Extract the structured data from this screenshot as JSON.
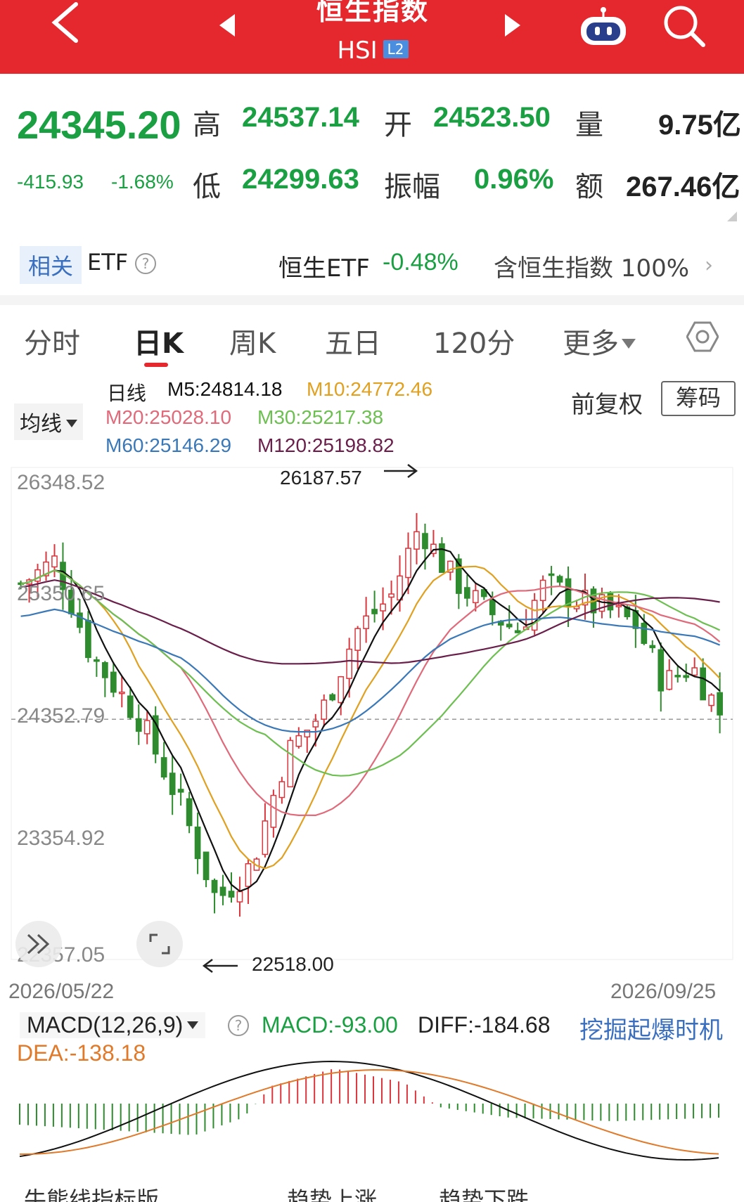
{
  "header": {
    "title": "恒生指数",
    "code": "HSI",
    "badge": "L2"
  },
  "quote": {
    "price": "24345.20",
    "change": "-415.93",
    "change_pct": "-1.68%",
    "high_label": "高",
    "high": "24537.14",
    "open_label": "开",
    "open": "24523.50",
    "volume_label": "量",
    "volume": "9.75亿",
    "low_label": "低",
    "low": "24299.63",
    "amplitude_label": "振幅",
    "amplitude": "0.96%",
    "amount_label": "额",
    "amount": "267.46亿"
  },
  "etf": {
    "tag": "相关",
    "label": "ETF",
    "help": "?",
    "name": "恒生ETF",
    "pct": "-0.48%",
    "holding": "含恒生指数 100%",
    "chevron": "›"
  },
  "tabs": [
    "分时",
    "日K",
    "周K",
    "五日",
    "120分",
    "更多"
  ],
  "ma": {
    "selector": "均线",
    "daily": "日线",
    "m5": "M5:24814.18",
    "m10": "M10:24772.46",
    "m20": "M20:25028.10",
    "m30": "M30:25217.38",
    "m60": "M60:25146.29",
    "m120": "M120:25198.82",
    "adjust": "前复权",
    "chips": "筹码"
  },
  "colors": {
    "up": "#d9363e",
    "down": "#2e8b2e",
    "m5": "#111111",
    "m10": "#e0a020",
    "m20": "#e06a7a",
    "m30": "#6cbf50",
    "m60": "#3a78b8",
    "m120": "#6a1f4a"
  },
  "chart_data": {
    "type": "candlestick",
    "y_ticks": [
      "26348.52",
      "25350.65",
      "24352.79",
      "23354.92",
      "22357.05"
    ],
    "y_range": [
      22357.05,
      26348.52
    ],
    "x_start": "2026/05/22",
    "x_end": "2026/09/25",
    "high_mark": "26187.57",
    "low_mark": "22518.00",
    "current_line": 24345.2
  },
  "macd": {
    "selector": "MACD(12,26,9)",
    "help": "?",
    "macd": "MACD:-93.00",
    "diff": "DIFF:-184.68",
    "link": "挖掘起爆时机",
    "dea": "DEA:-138.18"
  },
  "footer": {
    "indicator": "牛熊线指标版",
    "up_trend": "趋势上涨",
    "down_trend": "趋势下跌"
  }
}
